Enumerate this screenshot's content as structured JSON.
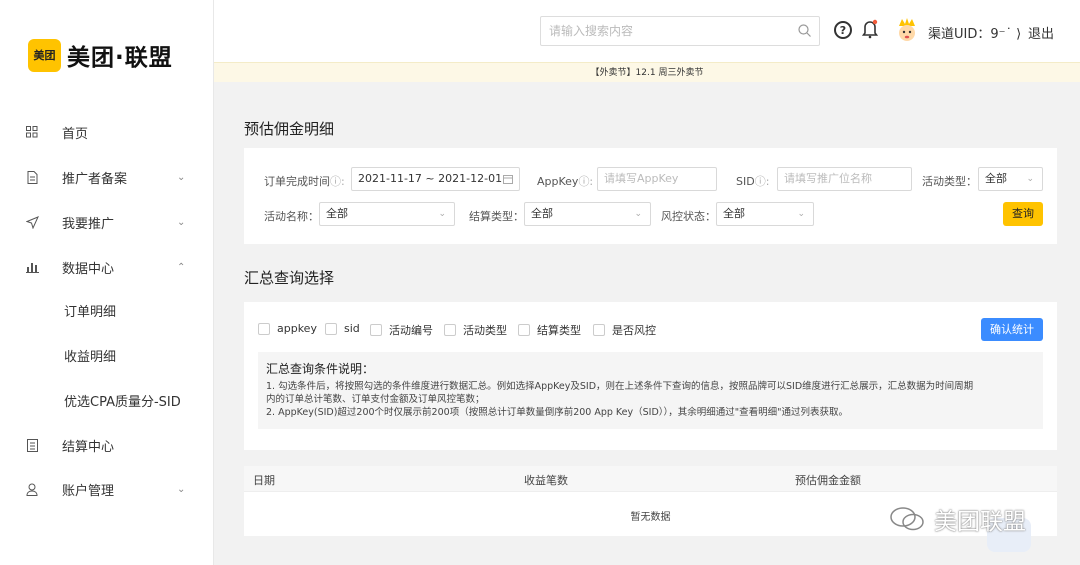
{
  "brand": {
    "badge": "美团",
    "name": "美团·联盟",
    "badge_color": "#ffc300"
  },
  "sidebar": {
    "items": [
      {
        "label": "首页",
        "icon": "grid-icon"
      },
      {
        "label": "推广者备案",
        "icon": "document-icon",
        "chevron": "⌄"
      },
      {
        "label": "我要推广",
        "icon": "send-icon",
        "chevron": "⌄"
      },
      {
        "label": "数据中心",
        "icon": "bar-chart-icon",
        "chevron": "⌃"
      },
      {
        "label": "订单明细"
      },
      {
        "label": "收益明细"
      },
      {
        "label": "优选CPA质量分-SID"
      },
      {
        "label": "结算中心",
        "icon": "ledger-icon"
      },
      {
        "label": "账户管理",
        "icon": "user-icon",
        "chevron": "⌄"
      }
    ]
  },
  "header": {
    "search_placeholder": "请输入搜索内容",
    "help": "?",
    "uid_label": "渠道UID：9⁻˙ ⟩",
    "logout": "退出"
  },
  "notice": "【外卖节】12.1 周三外卖节",
  "page": {
    "title": "预估佣金明细",
    "filters": {
      "order_time_label": "订单完成时间",
      "order_time_value": "2021-11-17 ~ 2021-12-01",
      "appkey_label": "AppKey",
      "appkey_placeholder": "请填写AppKey",
      "sid_label": "SID",
      "sid_placeholder": "请填写推广位名称",
      "activity_type_label": "活动类型：",
      "activity_type_value": "全部",
      "activity_name_label": "活动名称：",
      "activity_name_value": "全部",
      "settle_type_label": "结算类型：",
      "settle_type_value": "全部",
      "risk_label": "风控状态：",
      "risk_value": "全部",
      "query_button": "查询"
    },
    "summary": {
      "title": "汇总查询选择",
      "options": [
        "appkey",
        "sid",
        "活动编号",
        "活动类型",
        "结算类型",
        "是否风控"
      ],
      "confirm_button": "确认统计",
      "desc_title": "汇总查询条件说明：",
      "desc_lines": [
        "1. 勾选条件后，将按照勾选的条件维度进行数据汇总。例如选择AppKey及SID，则在上述条件下查询的信息，按照品牌可以SID维度进行汇总展示，汇总数据为时间周期",
        "内的订单总计笔数、订单支付金额及订单风控笔数；",
        "2. AppKey(SID)超过200个时仅展示前200项（按照总计订单数量倒序前200 App Key（SID）），其余明细通过\"查看明细\"通过列表获取。"
      ]
    },
    "table": {
      "columns": [
        "日期",
        "收益笔数",
        "预估佣金金额"
      ],
      "empty": "暂无数据"
    }
  },
  "watermark": "美团联盟",
  "colors": {
    "accent": "#ffc300",
    "primary": "#3b8cff",
    "notice_bg": "#fdf8e6"
  }
}
